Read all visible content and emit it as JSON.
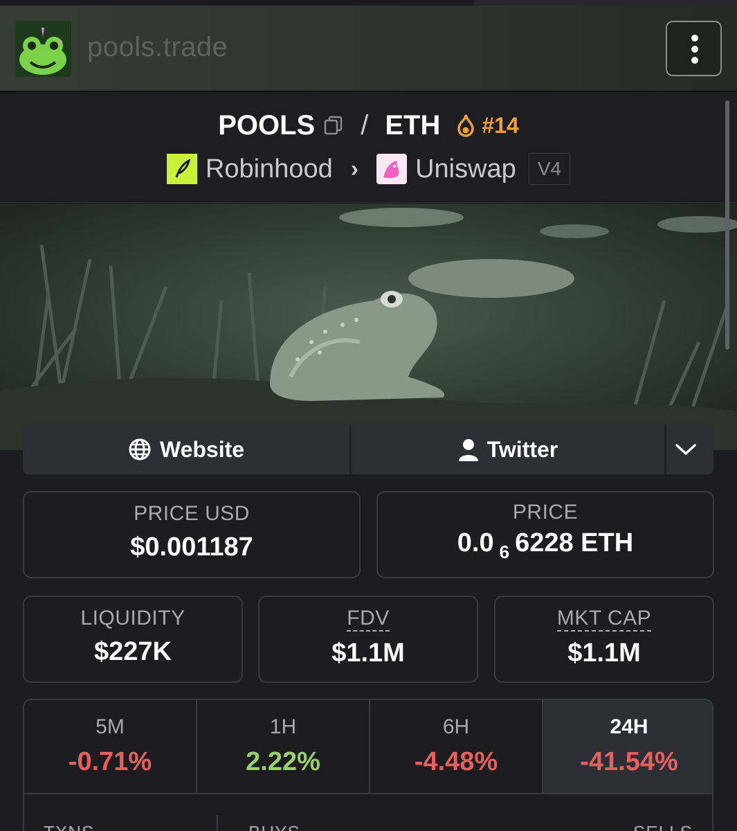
{
  "header": {
    "site_name": "pools.trade",
    "logo": "frog-unicorn-logo",
    "menu_icon": "vertical-dots-icon"
  },
  "pair": {
    "base": "POOLS",
    "separator": "/",
    "quote": "ETH",
    "rank": "#14",
    "chain": "Robinhood",
    "dex": "Uniswap",
    "version": "V4"
  },
  "links": {
    "website": "Website",
    "twitter": "Twitter"
  },
  "stats": {
    "price_usd_label": "PRICE USD",
    "price_usd": "$0.001187",
    "price_label": "PRICE",
    "price_prefix": "0.0",
    "price_zeros": "6",
    "price_suffix": "6228 ETH",
    "liquidity_label": "LIQUIDITY",
    "liquidity": "$227K",
    "fdv_label": "FDV",
    "fdv": "$1.1M",
    "mktcap_label": "MKT CAP",
    "mktcap": "$1.1M"
  },
  "changes": [
    {
      "period": "5M",
      "value": "-0.71%"
    },
    {
      "period": "1H",
      "value": "2.22%"
    },
    {
      "period": "6H",
      "value": "-4.48%"
    },
    {
      "period": "24H",
      "value": "-41.54%"
    }
  ],
  "txn_headers": {
    "txns": "TXNS",
    "buys": "BUYS",
    "sells": "SELLS"
  },
  "colors": {
    "negative": "#e5615e",
    "positive": "#9bd16a",
    "rank": "#f0a035"
  }
}
